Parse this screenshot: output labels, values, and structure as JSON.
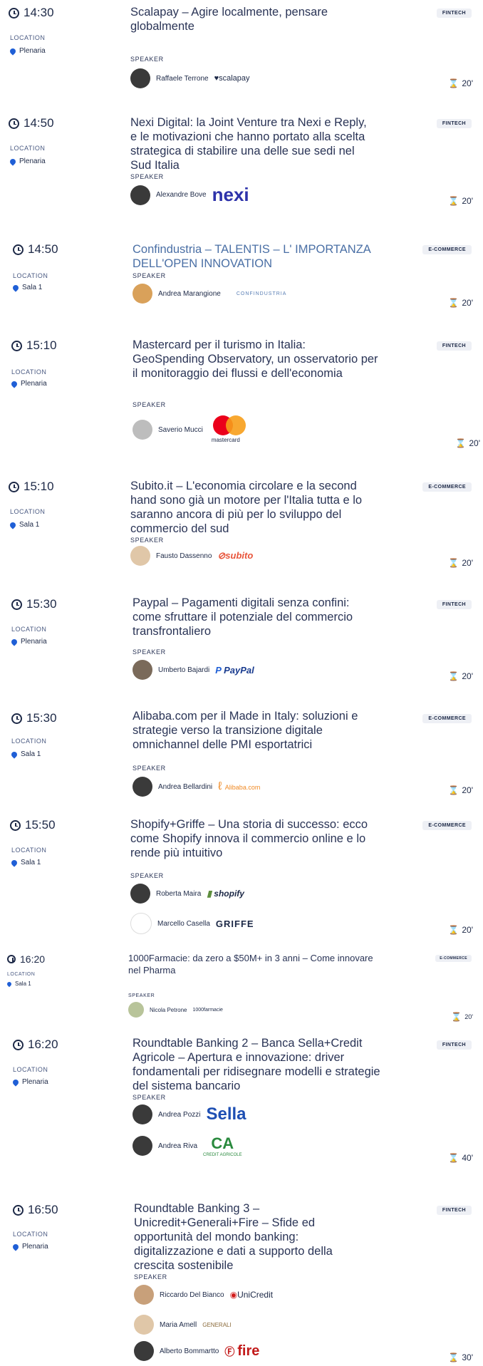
{
  "labels": {
    "location": "LOCATION",
    "speaker": "SPEAKER"
  },
  "colors": {
    "accent": "#1f5fd6",
    "text": "#1d2947",
    "muted": "#4a5a82",
    "tag_bg": "#eef0f5",
    "nexi": "#2d32aa",
    "paypal": "#1a3c8f",
    "sella": "#1e4fb3",
    "crif_green": "#2a8a3e",
    "unicredit_red": "#d11c1c",
    "fire_red": "#c21a1a",
    "subito_orange": "#e8543a"
  },
  "sessions": [
    {
      "time": "14:30",
      "location": "Plenaria",
      "tag": "FINTECH",
      "duration": "20'",
      "title": "Scalapay – Agire localmente, pensare globalmente",
      "speakers": [
        {
          "name": "Raffaele Terrone",
          "logo": "♥scalapay"
        }
      ]
    },
    {
      "time": "14:50",
      "location": "Plenaria",
      "tag": "FINTECH",
      "duration": "20'",
      "title": "Nexi Digital: la Joint Venture tra Nexi e Reply, e le motivazioni che hanno portato alla scelta strategica di stabilire una delle sue sedi nel Sud Italia",
      "speakers": [
        {
          "name": "Alexandre Bove",
          "logo": "nexi"
        }
      ]
    },
    {
      "time": "14:50",
      "location": "Sala 1",
      "tag": "E-COMMERCE",
      "duration": "20'",
      "title": "Confindustria – TALENTIS – L' IMPORTANZA DELL'OPEN INNOVATION",
      "speakers": [
        {
          "name": "Andrea Marangione",
          "logo": "CONFINDUSTRIA"
        }
      ]
    },
    {
      "time": "15:10",
      "location": "Plenaria",
      "tag": "FINTECH",
      "duration": "20'",
      "title": "Mastercard per il turismo in Italia: GeoSpending Observatory, un osservatorio per il monitoraggio dei flussi e dell'economia",
      "speakers": [
        {
          "name": "Saverio Mucci",
          "logo": "mastercard"
        }
      ]
    },
    {
      "time": "15:10",
      "location": "Sala 1",
      "tag": "E-COMMERCE",
      "duration": "20'",
      "title": "Subito.it – L'economia circolare e la second hand sono già un motore per l'Italia tutta e lo saranno ancora di più per lo sviluppo del commercio del sud",
      "speakers": [
        {
          "name": "Fausto Dassenno",
          "logo": "subito"
        }
      ]
    },
    {
      "time": "15:30",
      "location": "Plenaria",
      "tag": "FINTECH",
      "duration": "20'",
      "title": "Paypal – Pagamenti digitali senza confini: come sfruttare il potenziale del commercio transfrontaliero",
      "speakers": [
        {
          "name": "Umberto Bajardi",
          "logo": "PayPal"
        }
      ]
    },
    {
      "time": "15:30",
      "location": "Sala 1",
      "tag": "E-COMMERCE",
      "duration": "20'",
      "title": "Alibaba.com per il Made in Italy: soluzioni e strategie verso la transizione digitale omnichannel delle PMI esportatrici",
      "speakers": [
        {
          "name": "Andrea Bellardini",
          "logo": "Alibaba.com"
        }
      ]
    },
    {
      "time": "15:50",
      "location": "Sala 1",
      "tag": "E-COMMERCE",
      "duration": "20'",
      "title": "Shopify+Griffe – Una storia di successo: ecco come Shopify innova il commercio online e lo rende più intuitivo",
      "speakers": [
        {
          "name": "Roberta Maira",
          "logo": "shopify"
        },
        {
          "name": "Marcello Casella",
          "logo": "GRIFFE"
        }
      ]
    },
    {
      "time": "16:20",
      "location": "Sala 1",
      "tag": "E-COMMERCE",
      "duration": "20'",
      "title": "1000Farmacie: da zero a $50M+ in 3 anni – Come innovare nel Pharma",
      "speakers": [
        {
          "name": "Nicola Petrone",
          "logo": "1000farmacie"
        }
      ]
    },
    {
      "time": "16:20",
      "location": "Plenaria",
      "tag": "FINTECH",
      "duration": "40'",
      "title": "Roundtable Banking 2 – Banca Sella+Credit Agricole – Apertura e innovazione: driver fondamentali per ridisegnare modelli e strategie del sistema bancario",
      "speakers": [
        {
          "name": "Andrea Pozzi",
          "logo": "Sella"
        },
        {
          "name": "Andrea Riva",
          "logo": "CREDIT AGRICOLE"
        }
      ]
    },
    {
      "time": "16:50",
      "location": "Plenaria",
      "tag": "FINTECH",
      "duration": "30'",
      "title": "Roundtable Banking 3 – Unicredit+Generali+Fire – Sfide ed opportunità del mondo banking: digitalizzazione e dati a supporto della crescita sostenibile",
      "speakers": [
        {
          "name": "Riccardo Del Bianco",
          "logo": "UniCredit"
        },
        {
          "name": "Maria Amell",
          "logo": "GENERALI"
        },
        {
          "name": "Alberto Bommartto",
          "logo": "fire"
        }
      ]
    }
  ]
}
